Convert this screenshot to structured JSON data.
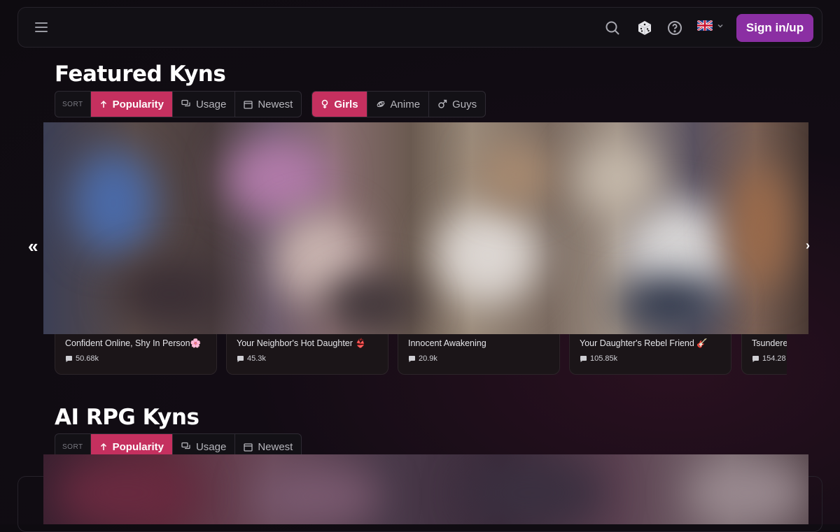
{
  "header": {
    "sign_in_label": "Sign in/up"
  },
  "sections": [
    {
      "title": "Featured Kyns",
      "sort_label": "SORT",
      "sort_options": [
        "Popularity",
        "Usage",
        "Newest"
      ],
      "category_options": [
        "Girls",
        "Anime",
        "Guys"
      ],
      "cards": [
        {
          "title": "Confident Online, Shy In Person🌸",
          "count": "50.68k"
        },
        {
          "title": "Your Neighbor's Hot Daughter 👙",
          "count": "45.3k"
        },
        {
          "title": "Innocent Awakening",
          "count": "20.9k"
        },
        {
          "title": "Your Daughter's Rebel Friend 🎸",
          "count": "105.85k"
        },
        {
          "title": "Tsundere",
          "count": "154.28"
        }
      ]
    },
    {
      "title": "AI RPG Kyns",
      "sort_label": "SORT",
      "sort_options": [
        "Popularity",
        "Usage",
        "Newest"
      ]
    }
  ],
  "colors": {
    "accent": "#c5305f",
    "sign_in_bg": "#8b2fa3",
    "background": "#0e0b10"
  },
  "icons": [
    "menu-icon",
    "search-icon",
    "dice-icon",
    "help-icon",
    "uk-flag-icon",
    "chevron-down-icon",
    "arrow-up-icon",
    "chat-bubbles-icon",
    "calendar-icon",
    "female-icon",
    "anime-icon",
    "male-icon",
    "comment-icon",
    "chevron-left-double-icon",
    "chevron-right-icon"
  ]
}
